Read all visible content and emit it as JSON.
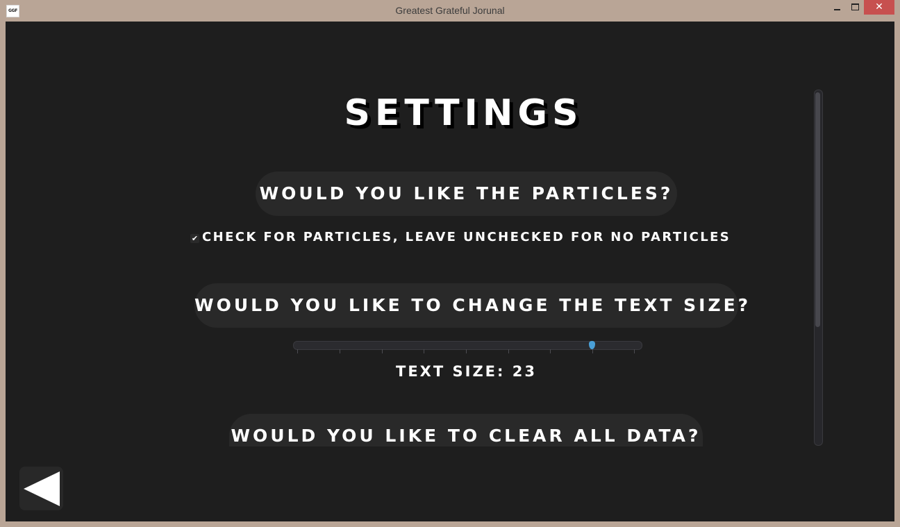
{
  "window": {
    "title": "Greatest Grateful Jorunal",
    "icon_label": "GGF",
    "close_glyph": "✕"
  },
  "settings": {
    "heading": "Settings",
    "particles": {
      "question": "Would you like the particles?",
      "checkbox_label": "Check for particles, leave unchecked for no particles",
      "checked": true,
      "check_glyph": "✔"
    },
    "text_size": {
      "question": "Would you like to change the text size?",
      "slider_value": 23,
      "label": "Text size: 23"
    },
    "clear_data": {
      "question": "Would you like to clear all data?"
    }
  },
  "colors": {
    "background": "#1e1e1e",
    "pill": "#292929",
    "accent": "#4aa0d8",
    "frame": "#b9a596",
    "close_button": "#c7504f"
  },
  "icons": {
    "back": "back-arrow-icon"
  }
}
